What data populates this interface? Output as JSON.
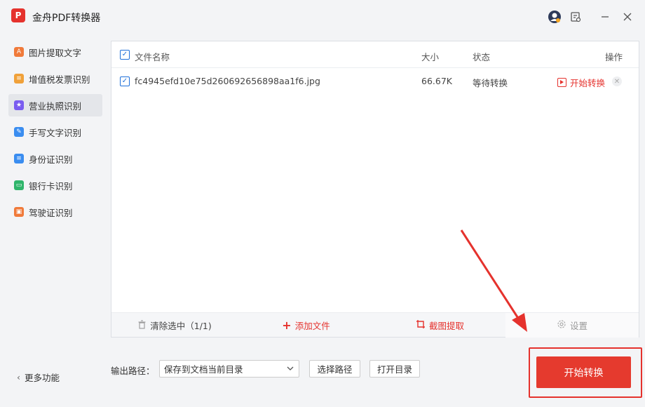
{
  "app": {
    "logo_text": "P",
    "title": "金舟PDF转换器"
  },
  "titlebar": {
    "icons": [
      "avatar-icon",
      "feedback-icon",
      "minimize-icon",
      "close-icon"
    ]
  },
  "sidebar": {
    "items": [
      {
        "label": "图片提取文字",
        "icon": "image-text-icon",
        "color": "#f07a3a"
      },
      {
        "label": "增值税发票识别",
        "icon": "invoice-icon",
        "color": "#f0a13a"
      },
      {
        "label": "营业执照识别",
        "icon": "license-icon",
        "color": "#7a5cf0",
        "active": true
      },
      {
        "label": "手写文字识别",
        "icon": "handwriting-icon",
        "color": "#3a8df0"
      },
      {
        "label": "身份证识别",
        "icon": "id-card-icon",
        "color": "#3a8df0"
      },
      {
        "label": "银行卡识别",
        "icon": "bank-card-icon",
        "color": "#2fb56b"
      },
      {
        "label": "驾驶证识别",
        "icon": "driver-license-icon",
        "color": "#f07a3a"
      }
    ],
    "more_label": "更多功能"
  },
  "table": {
    "headers": {
      "name": "文件名称",
      "size": "大小",
      "status": "状态",
      "action": "操作"
    },
    "rows": [
      {
        "name": "fc4945efd10e75d260692656898aa1f6.jpg",
        "size": "66.67K",
        "status": "等待转换",
        "action": "开始转换",
        "checked": true
      }
    ]
  },
  "footer": {
    "clear_label": "清除选中（1/1)",
    "add_label": "添加文件",
    "crop_label": "截图提取",
    "settings_label": "设置"
  },
  "output": {
    "label": "输出路径：",
    "selected": "保存到文档当前目录",
    "choose_path": "选择路径",
    "open_dir": "打开目录"
  },
  "start_button": "开始转换",
  "colors": {
    "accent": "#e5322d",
    "checkbox": "#1e6fd9"
  }
}
